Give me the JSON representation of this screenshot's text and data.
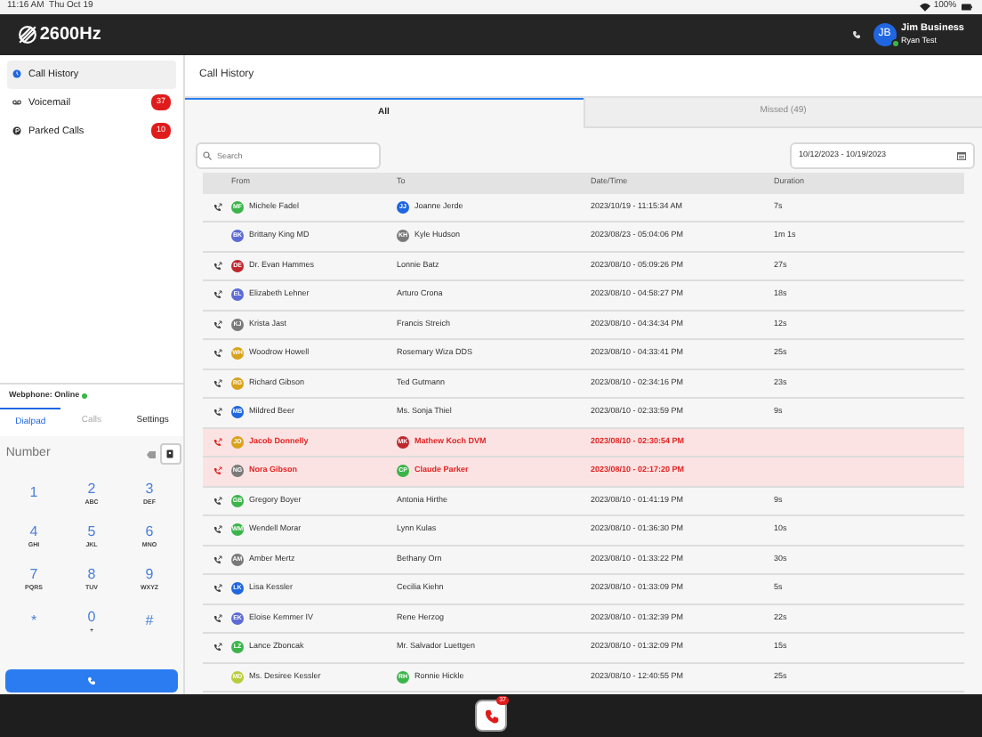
{
  "status_bar": {
    "time": "11:16 AM",
    "date": "Thu Oct 19",
    "battery": "100%"
  },
  "header": {
    "logo": "2600Hz",
    "avatar": "JB",
    "online": true,
    "user_name": "Jim Business",
    "user_sub": "Ryan Test"
  },
  "sidebar": {
    "items": [
      {
        "label": "Call History",
        "selected": true,
        "kind": "history"
      },
      {
        "label": "Voicemail",
        "selected": false,
        "kind": "voicemail",
        "badge": "37"
      },
      {
        "label": "Parked Calls",
        "selected": false,
        "kind": "parked",
        "badge": "10"
      }
    ]
  },
  "webphone": {
    "status": "Webphone: Online",
    "online": true,
    "tabs": [
      {
        "label": "Dialpad",
        "selected": true
      },
      {
        "label": "Calls",
        "selected": false
      },
      {
        "label": "Settings",
        "selected": false
      }
    ],
    "number_field": {
      "placeholder": "Number"
    },
    "keys": [
      {
        "digit": "1"
      },
      {
        "digit": "2",
        "letters": "ABC"
      },
      {
        "digit": "3",
        "letters": "DEF"
      },
      {
        "digit": "4",
        "letters": "GHI"
      },
      {
        "digit": "5",
        "letters": "JKL"
      },
      {
        "digit": "6",
        "letters": "MNO"
      },
      {
        "digit": "7",
        "letters": "PQRS"
      },
      {
        "digit": "8",
        "letters": "TUV"
      },
      {
        "digit": "9",
        "letters": "WXYZ"
      },
      {
        "digit": "*"
      },
      {
        "digit": "0",
        "letters": "+"
      },
      {
        "digit": "#"
      }
    ]
  },
  "page_title": "Call History",
  "tabs": [
    {
      "label": "All",
      "selected": true
    },
    {
      "label": "Missed (49)",
      "selected": false
    }
  ],
  "search": {
    "placeholder": "Search"
  },
  "date_range": {
    "value": "10/12/2023 - 10/19/2023"
  },
  "table": {
    "columns": [
      "From",
      "To",
      "Date/Time",
      "Duration"
    ],
    "rows": [
      {
        "call_icon": true,
        "missed": false,
        "from": {
          "initials": "MF",
          "color": "#3bb54a",
          "name": "Michele Fadel"
        },
        "to": {
          "initials": "JJ",
          "color": "#1f66e0",
          "name": "Joanne Jerde"
        },
        "date": "2023/10/19 - 11:15:34 AM",
        "duration": "7s"
      },
      {
        "call_icon": false,
        "missed": false,
        "from": {
          "initials": "BK",
          "color": "#5c6bd6",
          "name": "Brittany King MD"
        },
        "to": {
          "initials": "KH",
          "color": "#7a7a7a",
          "name": "Kyle Hudson"
        },
        "date": "2023/08/23 - 05:04:06 PM",
        "duration": "1m 1s"
      },
      {
        "call_icon": true,
        "missed": false,
        "from": {
          "initials": "DE",
          "color": "#c0262d",
          "name": "Dr. Evan Hammes"
        },
        "to": {
          "name": "Lonnie Batz"
        },
        "date": "2023/08/10 - 05:09:26 PM",
        "duration": "27s"
      },
      {
        "call_icon": true,
        "missed": false,
        "from": {
          "initials": "EL",
          "color": "#5c6bd6",
          "name": "Elizabeth Lehner"
        },
        "to": {
          "name": "Arturo Crona"
        },
        "date": "2023/08/10 - 04:58:27 PM",
        "duration": "18s"
      },
      {
        "call_icon": true,
        "missed": false,
        "from": {
          "initials": "KJ",
          "color": "#7a7a7a",
          "name": "Krista Jast"
        },
        "to": {
          "name": "Francis Streich"
        },
        "date": "2023/08/10 - 04:34:34 PM",
        "duration": "12s"
      },
      {
        "call_icon": true,
        "missed": false,
        "from": {
          "initials": "WH",
          "color": "#d9a21b",
          "name": "Woodrow Howell"
        },
        "to": {
          "name": "Rosemary Wiza DDS"
        },
        "date": "2023/08/10 - 04:33:41 PM",
        "duration": "25s"
      },
      {
        "call_icon": true,
        "missed": false,
        "from": {
          "initials": "RG",
          "color": "#d9a21b",
          "name": "Richard Gibson"
        },
        "to": {
          "name": "Ted Gutmann"
        },
        "date": "2023/08/10 - 02:34:16 PM",
        "duration": "23s"
      },
      {
        "call_icon": true,
        "missed": false,
        "from": {
          "initials": "MB",
          "color": "#1f66e0",
          "name": "Mildred Beer"
        },
        "to": {
          "name": "Ms. Sonja Thiel"
        },
        "date": "2023/08/10 - 02:33:59 PM",
        "duration": "9s"
      },
      {
        "call_icon": true,
        "missed": true,
        "from": {
          "initials": "JD",
          "color": "#d9a21b",
          "name": "Jacob Donnelly"
        },
        "to": {
          "initials": "MK",
          "color": "#c0262d",
          "name": "Mathew Koch DVM"
        },
        "date": "2023/08/10 - 02:30:54 PM"
      },
      {
        "call_icon": true,
        "missed": true,
        "from": {
          "initials": "NG",
          "color": "#7a7a7a",
          "name": "Nora Gibson"
        },
        "to": {
          "initials": "CP",
          "color": "#3bb54a",
          "name": "Claude Parker"
        },
        "date": "2023/08/10 - 02:17:20 PM"
      },
      {
        "call_icon": true,
        "missed": false,
        "from": {
          "initials": "GB",
          "color": "#3bb54a",
          "name": "Gregory Boyer"
        },
        "to": {
          "name": "Antonia Hirthe"
        },
        "date": "2023/08/10 - 01:41:19 PM",
        "duration": "9s"
      },
      {
        "call_icon": true,
        "missed": false,
        "from": {
          "initials": "WM",
          "color": "#3bb54a",
          "name": "Wendell Morar"
        },
        "to": {
          "name": "Lynn Kulas"
        },
        "date": "2023/08/10 - 01:36:30 PM",
        "duration": "10s"
      },
      {
        "call_icon": true,
        "missed": false,
        "from": {
          "initials": "AM",
          "color": "#7a7a7a",
          "name": "Amber Mertz"
        },
        "to": {
          "name": "Bethany Orn"
        },
        "date": "2023/08/10 - 01:33:22 PM",
        "duration": "30s"
      },
      {
        "call_icon": true,
        "missed": false,
        "from": {
          "initials": "LK",
          "color": "#1f66e0",
          "name": "Lisa Kessler"
        },
        "to": {
          "name": "Cecilia Kiehn"
        },
        "date": "2023/08/10 - 01:33:09 PM",
        "duration": "5s"
      },
      {
        "call_icon": true,
        "missed": false,
        "from": {
          "initials": "EK",
          "color": "#5c6bd6",
          "name": "Eloise Kemmer IV"
        },
        "to": {
          "name": "Rene Herzog"
        },
        "date": "2023/08/10 - 01:32:39 PM",
        "duration": "22s"
      },
      {
        "call_icon": true,
        "missed": false,
        "from": {
          "initials": "LZ",
          "color": "#3bb54a",
          "name": "Lance Zboncak"
        },
        "to": {
          "name": "Mr. Salvador Luettgen"
        },
        "date": "2023/08/10 - 01:32:09 PM",
        "duration": "15s"
      },
      {
        "call_icon": false,
        "missed": false,
        "from": {
          "initials": "MD",
          "color": "#b8cc3a",
          "name": "Ms. Desiree Kessler"
        },
        "to": {
          "initials": "RH",
          "color": "#3bb54a",
          "name": "Ronnie Hickle"
        },
        "date": "2023/08/10 - 12:40:55 PM",
        "duration": "25s"
      }
    ]
  },
  "dock": {
    "badge": "37"
  }
}
